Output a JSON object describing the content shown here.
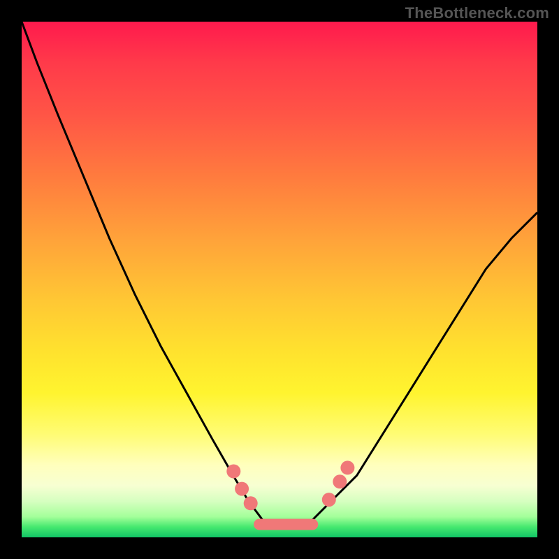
{
  "attribution": "TheBottleneck.com",
  "chart_data": {
    "type": "line",
    "title": "",
    "xlabel": "",
    "ylabel": "",
    "xlim": [
      0,
      1
    ],
    "ylim": [
      0,
      1
    ],
    "series": [
      {
        "name": "curve",
        "x": [
          0.0,
          0.03,
          0.07,
          0.12,
          0.17,
          0.22,
          0.27,
          0.32,
          0.37,
          0.41,
          0.44,
          0.47,
          0.5,
          0.53,
          0.56,
          0.6,
          0.65,
          0.7,
          0.75,
          0.8,
          0.85,
          0.9,
          0.95,
          1.0
        ],
        "y": [
          1.0,
          0.92,
          0.82,
          0.7,
          0.58,
          0.47,
          0.37,
          0.28,
          0.19,
          0.12,
          0.07,
          0.03,
          0.02,
          0.02,
          0.03,
          0.07,
          0.12,
          0.2,
          0.28,
          0.36,
          0.44,
          0.52,
          0.58,
          0.63
        ],
        "color": "#000000",
        "width": 3
      }
    ],
    "markers": [
      {
        "name": "left-bead-1",
        "x": 0.411,
        "y": 0.128,
        "r": 10,
        "color": "#f07878"
      },
      {
        "name": "left-bead-2",
        "x": 0.427,
        "y": 0.094,
        "r": 10,
        "color": "#f07878"
      },
      {
        "name": "left-bead-3",
        "x": 0.444,
        "y": 0.066,
        "r": 10,
        "color": "#f07878"
      },
      {
        "name": "right-bead-1",
        "x": 0.596,
        "y": 0.073,
        "r": 10,
        "color": "#f07878"
      },
      {
        "name": "right-bead-2",
        "x": 0.617,
        "y": 0.108,
        "r": 10,
        "color": "#f07878"
      },
      {
        "name": "right-bead-3",
        "x": 0.632,
        "y": 0.135,
        "r": 10,
        "color": "#f07878"
      }
    ],
    "trough_band": {
      "name": "trough-band",
      "x_start": 0.45,
      "x_end": 0.575,
      "y": 0.025,
      "thickness": 16,
      "color": "#f07878"
    },
    "gradient_stops": [
      {
        "offset": 0.0,
        "color": "#ff1a4d"
      },
      {
        "offset": 0.3,
        "color": "#ff7b3e"
      },
      {
        "offset": 0.6,
        "color": "#ffe22e"
      },
      {
        "offset": 0.85,
        "color": "#ffffbd"
      },
      {
        "offset": 1.0,
        "color": "#11c566"
      }
    ]
  }
}
